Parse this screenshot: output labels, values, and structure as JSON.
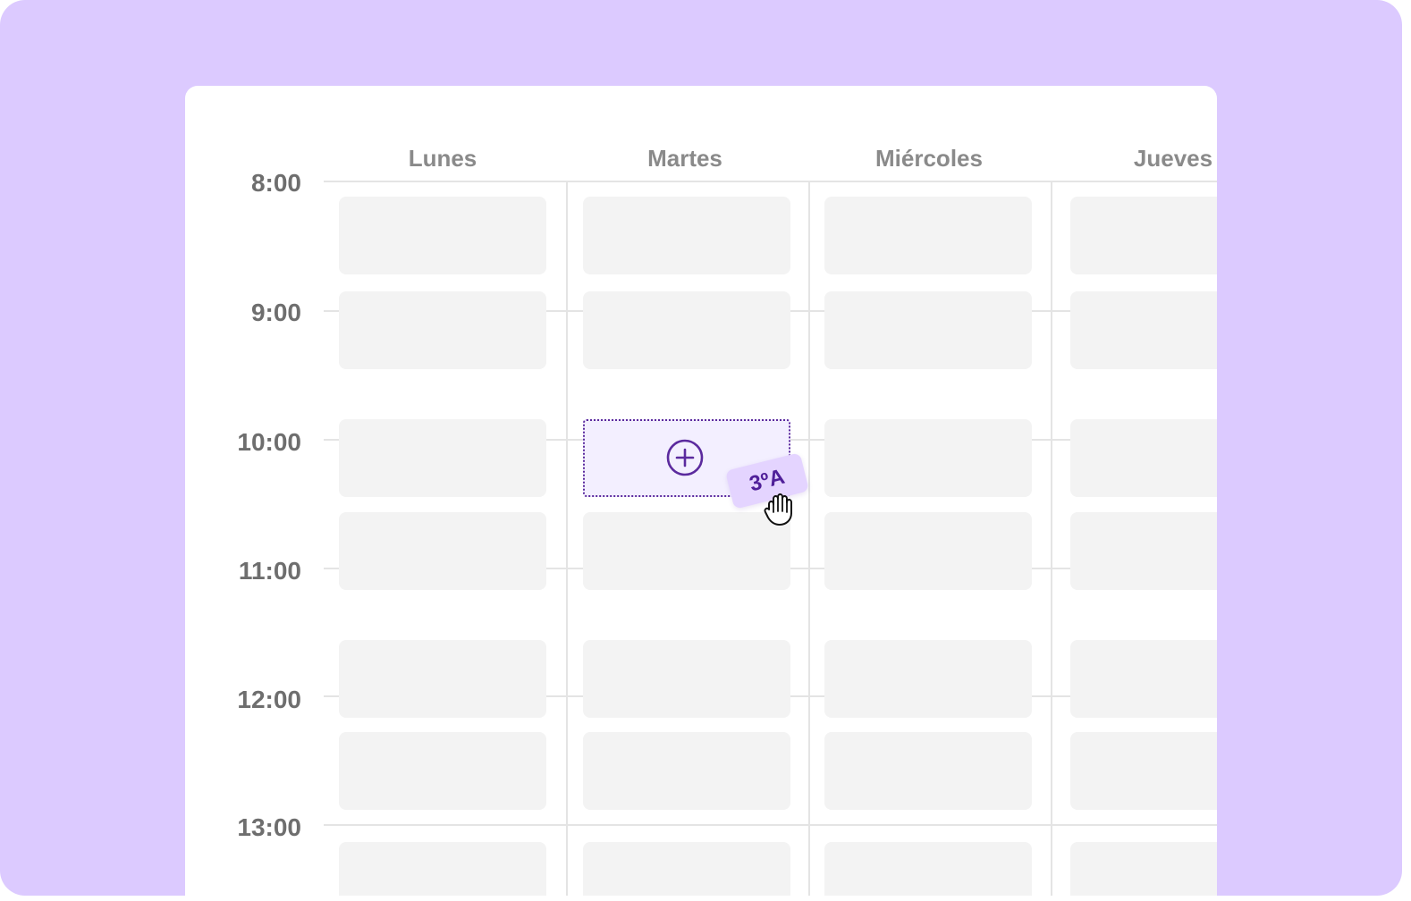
{
  "days": [
    "Lunes",
    "Martes",
    "Miércoles",
    "Jueves"
  ],
  "times": [
    "8:00",
    "9:00",
    "10:00",
    "11:00",
    "12:00",
    "13:00"
  ],
  "drag_chip": {
    "label": "3ºA"
  },
  "icons": {
    "add": "plus-circle-icon",
    "cursor": "grab-hand-icon"
  },
  "colors": {
    "frame": "#dccaff",
    "accent": "#5b2a9e",
    "chip": "#e4d4ff",
    "slot": "#f3f3f3"
  }
}
